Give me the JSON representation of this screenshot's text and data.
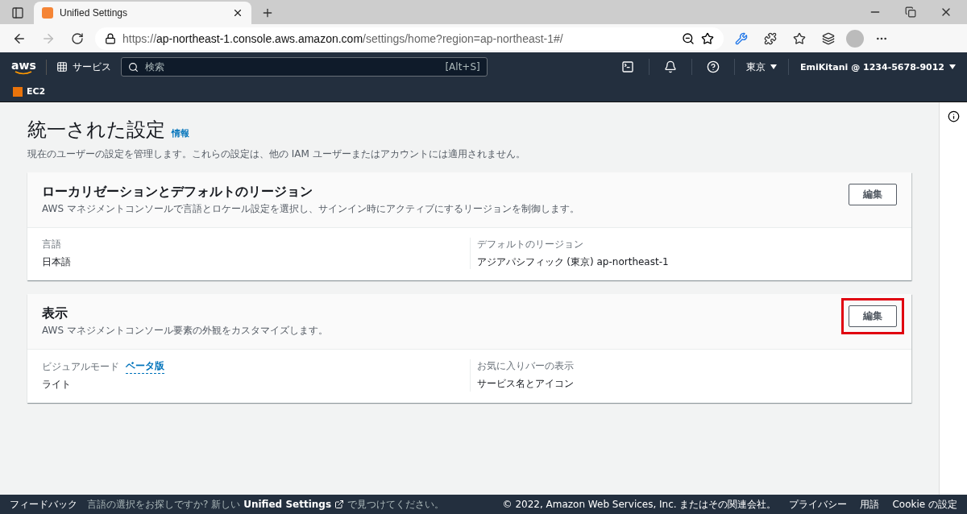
{
  "browser": {
    "tab_title": "Unified Settings",
    "url_scheme": "https://",
    "url_host": "ap-northeast-1.console.aws.amazon.com",
    "url_path": "/settings/home?region=ap-northeast-1#/"
  },
  "nav": {
    "logo": "aws",
    "services": "サービス",
    "search": {
      "placeholder": "検索"
    },
    "shortcut": "[Alt+S]",
    "region": "東京",
    "account": "EmiKitani @ 1234-5678-9012"
  },
  "favorites": [
    {
      "label": "EC2"
    }
  ],
  "page": {
    "title": "統一された設定",
    "info_link": "情報",
    "description": "現在のユーザーの設定を管理します。これらの設定は、他の IAM ユーザーまたはアカウントには適用されません。"
  },
  "cards": [
    {
      "title": "ローカリゼーションとデフォルトのリージョン",
      "description": "AWS マネジメントコンソールで言語とロケール設定を選択し、サインイン時にアクティブにするリージョンを制御します。",
      "button": {
        "label": "編集",
        "highlighted": false
      },
      "fields": [
        {
          "label": "言語",
          "value": "日本語"
        },
        {
          "label": "デフォルトのリージョン",
          "value": "アジアパシフィック (東京) ap-northeast-1"
        }
      ]
    },
    {
      "title": "表示",
      "description": "AWS マネジメントコンソール要素の外観をカスタマイズします。",
      "button": {
        "label": "編集",
        "highlighted": true
      },
      "fields": [
        {
          "label": "ビジュアルモード",
          "badge": "ベータ版",
          "value": "ライト"
        },
        {
          "label": "お気に入りバーの表示",
          "value": "サービス名とアイコン"
        }
      ]
    }
  ],
  "footer": {
    "feedback": "フィードバック",
    "notice_before": "言語の選択をお探しですか? 新しい",
    "notice_link": "Unified Settings",
    "notice_after": "で見つけてください。",
    "copyright": "© 2022, Amazon Web Services, Inc. またはその関連会社。",
    "links": [
      "プライバシー",
      "用語",
      "Cookie の設定"
    ]
  }
}
